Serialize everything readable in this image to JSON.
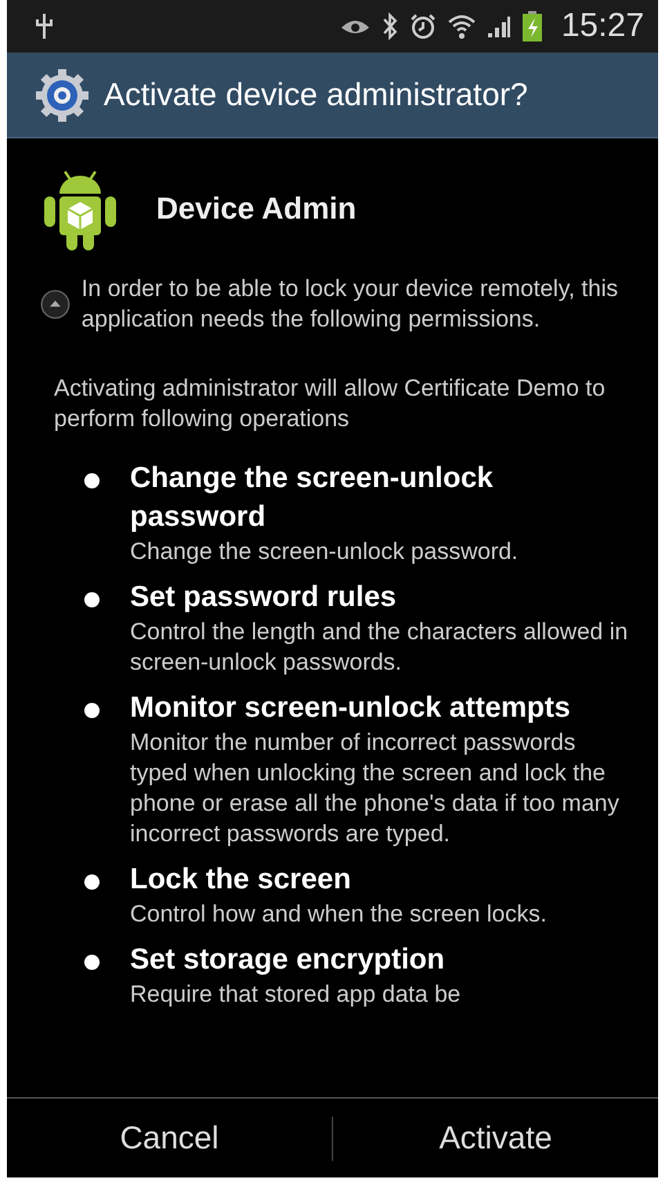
{
  "status_bar": {
    "time": "15:27"
  },
  "dialog": {
    "title": "Activate device administrator?"
  },
  "app": {
    "name": "Device Admin"
  },
  "notice": {
    "text": "In order to be able to lock your device remotely, this application needs the following permissions.",
    "expanded": true
  },
  "intro": "Activating administrator will allow Certificate Demo to perform following operations",
  "permissions": [
    {
      "title": "Change the screen-unlock password",
      "description": "Change the screen-unlock password."
    },
    {
      "title": "Set password rules",
      "description": "Control the length and the characters allowed in screen-unlock passwords."
    },
    {
      "title": "Monitor screen-unlock attempts",
      "description": "Monitor the number of incorrect passwords typed when unlocking the screen and lock the phone or erase all the phone's data if too many incorrect passwords are typed."
    },
    {
      "title": "Lock the screen",
      "description": "Control how and when the screen locks."
    },
    {
      "title": "Set storage encryption",
      "description": "Require that stored app data be"
    }
  ],
  "buttons": [
    {
      "label": "Cancel"
    },
    {
      "label": "Activate"
    }
  ]
}
